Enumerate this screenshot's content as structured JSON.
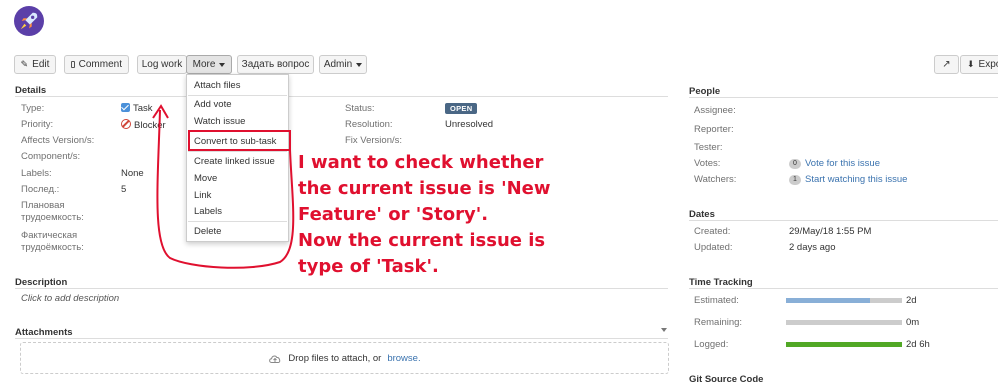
{
  "toolbar": {
    "edit": "Edit",
    "comment": "Comment",
    "log_work": "Log work",
    "more": "More",
    "ask_question": "Задать вопрос",
    "admin": "Admin",
    "export": "Expo"
  },
  "details": {
    "title": "Details",
    "type_label": "Type:",
    "type_value": "Task",
    "priority_label": "Priority:",
    "priority_value": "Blocker",
    "affects_label": "Affects Version/s:",
    "component_label": "Component/s:",
    "labels_label": "Labels:",
    "labels_value": "None",
    "last_label": "Послед.:",
    "last_value": "5",
    "planned_label_1": "Плановая",
    "planned_label_2": "трудоемкость:",
    "actual_label_1": "Фактическая",
    "actual_label_2": "трудоёмкость:",
    "status_label": "Status:",
    "status_value": "OPEN",
    "resolution_label": "Resolution:",
    "resolution_value": "Unresolved",
    "fix_label": "Fix Version/s:"
  },
  "more_menu": {
    "items": [
      "Attach files",
      "Add vote",
      "Watch issue",
      "Convert to sub-task",
      "Create linked issue",
      "Move",
      "Link",
      "Labels",
      "Delete"
    ]
  },
  "annotation": {
    "text": "I want to check whether\nthe current issue is 'New\nFeature' or 'Story'.\nNow the current issue is\ntype of 'Task'."
  },
  "description": {
    "title": "Description",
    "placeholder": "Click to add description"
  },
  "attachments": {
    "title": "Attachments",
    "drop_text": "Drop files to attach, or",
    "browse": "browse."
  },
  "people": {
    "title": "People",
    "assignee_label": "Assignee:",
    "reporter_label": "Reporter:",
    "tester_label": "Tester:",
    "votes_label": "Votes:",
    "votes_count": "0",
    "votes_link": "Vote for this issue",
    "watchers_label": "Watchers:",
    "watchers_count": "1",
    "watchers_link": "Start watching this issue"
  },
  "dates": {
    "title": "Dates",
    "created_label": "Created:",
    "created_value": "29/May/18 1:55 PM",
    "updated_label": "Updated:",
    "updated_value": "2 days ago"
  },
  "time_tracking": {
    "title": "Time Tracking",
    "estimated_label": "Estimated:",
    "estimated_value": "2d",
    "estimated_fraction": 0.72,
    "remaining_label": "Remaining:",
    "remaining_value": "0m",
    "remaining_fraction": 0,
    "logged_label": "Logged:",
    "logged_value": "2d 6h",
    "logged_fraction": 1,
    "colors": {
      "estimated": "#89afd7",
      "remaining": "#cccccc",
      "logged": "#51a825"
    }
  },
  "git": {
    "title": "Git Source Code"
  },
  "colors": {
    "annotation": "#e0102f",
    "status_badge": "#4a6785",
    "link": "#3b73af"
  }
}
